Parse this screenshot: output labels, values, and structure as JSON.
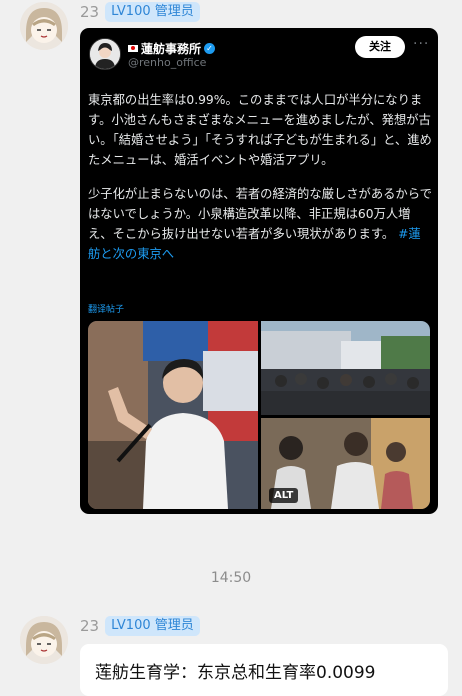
{
  "messages": [
    {
      "sender": {
        "number": "23",
        "badge": "LV100 管理员"
      },
      "tweet": {
        "account_name": "蓮舫事務所",
        "handle": "@renho_office",
        "follow_label": "关注",
        "paragraph1": "東京都の出生率は0.99%。このままでは人口が半分になります。小池さんもさまざまなメニューを進めましたが、発想が古い。「結婚させよう」「そうすれば子どもが生まれる」と、進めたメニューは、婚活イベントや婚活アプリ。",
        "paragraph2": "少子化が止まらないのは、若者の経済的な厳しさがあるからではないでしょうか。小泉構造改革以降、非正規は60万人増え、そこから抜け出せない若者が多い現状があります。",
        "hashtag": "#蓮舫と次の東京へ",
        "translate_label": "翻译帖子",
        "alt_label": "ALT"
      }
    },
    {
      "sender": {
        "number": "23",
        "badge": "LV100 管理员"
      },
      "text": "莲舫生育学：东京总和生育率0.0099"
    }
  ],
  "timestamp": "14:50",
  "colors": {
    "badge_bg": "#cfe6fb",
    "badge_text": "#2f86d6",
    "hashtag": "#1d9bf0",
    "background": "#f0f0f0"
  }
}
